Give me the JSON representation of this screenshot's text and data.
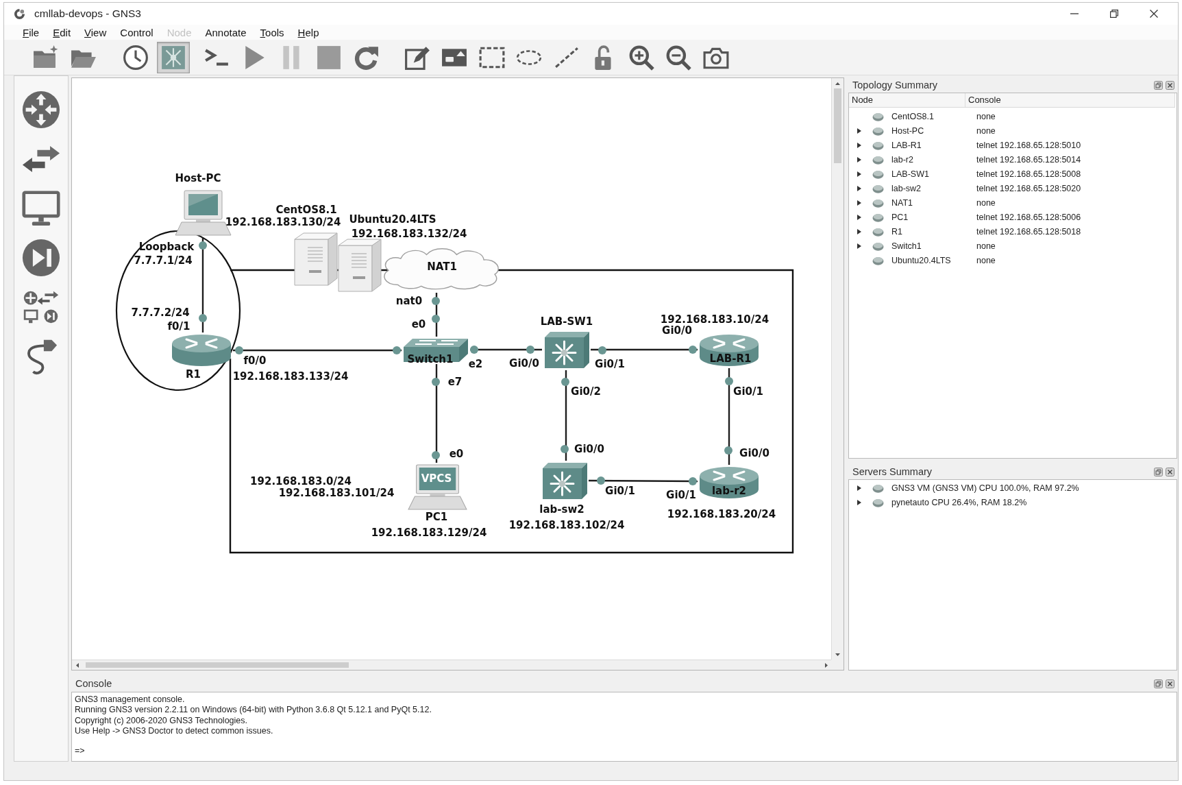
{
  "window": {
    "title": "cmllab-devops - GNS3"
  },
  "menu": [
    {
      "label": "File",
      "mnemonic": true,
      "disabled": false
    },
    {
      "label": "Edit",
      "mnemonic": true,
      "disabled": false
    },
    {
      "label": "View",
      "mnemonic": true,
      "disabled": false
    },
    {
      "label": "Control",
      "mnemonic": false,
      "disabled": false
    },
    {
      "label": "Node",
      "mnemonic": false,
      "disabled": true
    },
    {
      "label": "Annotate",
      "mnemonic": false,
      "disabled": false
    },
    {
      "label": "Tools",
      "mnemonic": true,
      "disabled": false
    },
    {
      "label": "Help",
      "mnemonic": true,
      "disabled": false
    }
  ],
  "toolbar": {
    "groups": [
      [
        {
          "kind": "new-project",
          "pressed": false
        },
        {
          "kind": "open-project",
          "pressed": false
        }
      ],
      [
        {
          "kind": "snapshot",
          "pressed": false
        },
        {
          "kind": "interface-labels",
          "pressed": true
        }
      ],
      [
        {
          "kind": "console",
          "pressed": false
        },
        {
          "kind": "start",
          "pressed": false
        },
        {
          "kind": "suspend",
          "pressed": false
        },
        {
          "kind": "stop",
          "pressed": false
        },
        {
          "kind": "reload",
          "pressed": false
        }
      ],
      [
        {
          "kind": "note",
          "pressed": false
        },
        {
          "kind": "image",
          "pressed": false
        },
        {
          "kind": "rectangle",
          "pressed": false
        },
        {
          "kind": "ellipse",
          "pressed": false
        },
        {
          "kind": "line",
          "pressed": false
        },
        {
          "kind": "lock",
          "pressed": false
        },
        {
          "kind": "zoom-in",
          "pressed": false
        },
        {
          "kind": "zoom-out",
          "pressed": false
        },
        {
          "kind": "screenshot",
          "pressed": false
        }
      ]
    ]
  },
  "node_palette": [
    {
      "kind": "routers"
    },
    {
      "kind": "switches"
    },
    {
      "kind": "end-devices"
    },
    {
      "kind": "security"
    },
    {
      "kind": "all-devices"
    },
    {
      "kind": "link"
    }
  ],
  "topology": {
    "nodes": [
      {
        "kind": "computer",
        "label": "Host-PC"
      },
      {
        "kind": "server",
        "label": "CentOS8.1"
      },
      {
        "kind": "server",
        "label": "Ubuntu20.4LTS"
      },
      {
        "kind": "cloud",
        "label": "NAT1"
      },
      {
        "kind": "router",
        "label": "R1"
      },
      {
        "kind": "ethernet-switch",
        "label": "Switch1"
      },
      {
        "kind": "vpcs",
        "label": "PC1",
        "screen": "VPCS"
      },
      {
        "kind": "multilayer-switch",
        "label": "LAB-SW1"
      },
      {
        "kind": "router",
        "label": "LAB-R1"
      },
      {
        "kind": "multilayer-switch",
        "label": "lab-sw2"
      },
      {
        "kind": "router",
        "label": "lab-r2"
      }
    ],
    "links": [
      {
        "ports": [
          "Loopback",
          "f0/1"
        ]
      },
      {
        "ports": [
          "f0/0"
        ]
      },
      {
        "ports": [
          "nat0",
          "e0"
        ]
      },
      {
        "ports": [
          "e7",
          "e0"
        ]
      },
      {
        "ports": [
          "e2",
          "Gi0/0"
        ]
      },
      {
        "ports": [
          "Gi0/1",
          "Gi0/0"
        ]
      },
      {
        "ports": [
          "Gi0/2",
          "Gi0/0"
        ]
      },
      {
        "ports": [
          "Gi0/1",
          "Gi0/1"
        ]
      },
      {
        "ports": [
          "Gi0/1",
          "Gi0/0"
        ]
      }
    ],
    "notes": [
      "192.168.183.130/24",
      "192.168.183.132/24",
      "7.7.7.1/24",
      "7.7.7.2/24",
      "192.168.183.10/24",
      "192.168.183.133/24",
      "192.168.183.0/24",
      "192.168.183.101/24",
      "192.168.183.20/24",
      "192.168.183.102/24",
      "192.168.183.129/24"
    ],
    "drawings": [
      {
        "kind": "ellipse"
      },
      {
        "kind": "rectangle"
      }
    ]
  },
  "topology_summary": {
    "title": "Topology Summary",
    "columns": [
      "Node",
      "Console"
    ],
    "rows": [
      {
        "node": "CentOS8.1",
        "console": "none",
        "expandable": false
      },
      {
        "node": "Host-PC",
        "console": "none",
        "expandable": true
      },
      {
        "node": "LAB-R1",
        "console": "telnet 192.168.65.128:5010",
        "expandable": true
      },
      {
        "node": "lab-r2",
        "console": "telnet 192.168.65.128:5014",
        "expandable": true
      },
      {
        "node": "LAB-SW1",
        "console": "telnet 192.168.65.128:5008",
        "expandable": true
      },
      {
        "node": "lab-sw2",
        "console": "telnet 192.168.65.128:5020",
        "expandable": true
      },
      {
        "node": "NAT1",
        "console": "none",
        "expandable": true
      },
      {
        "node": "PC1",
        "console": "telnet 192.168.65.128:5006",
        "expandable": true
      },
      {
        "node": "R1",
        "console": "telnet 192.168.65.128:5018",
        "expandable": true
      },
      {
        "node": "Switch1",
        "console": "none",
        "expandable": true
      },
      {
        "node": "Ubuntu20.4LTS",
        "console": "none",
        "expandable": false
      }
    ]
  },
  "servers_summary": {
    "title": "Servers Summary",
    "rows": [
      {
        "text": "GNS3 VM (GNS3 VM) CPU 100.0%, RAM 97.2%",
        "expandable": true
      },
      {
        "text": "pynetauto CPU 26.4%, RAM 18.2%",
        "expandable": true
      }
    ]
  },
  "console": {
    "title": "Console",
    "lines": [
      "GNS3 management console.",
      "Running GNS3 version 2.2.11 on Windows (64-bit) with Python 3.6.8 Qt 5.12.1 and PyQt 5.12.",
      "Copyright (c) 2006-2020 GNS3 Technologies.",
      "Use Help -> GNS3 Doctor to detect common issues."
    ],
    "prompt": "=>"
  }
}
